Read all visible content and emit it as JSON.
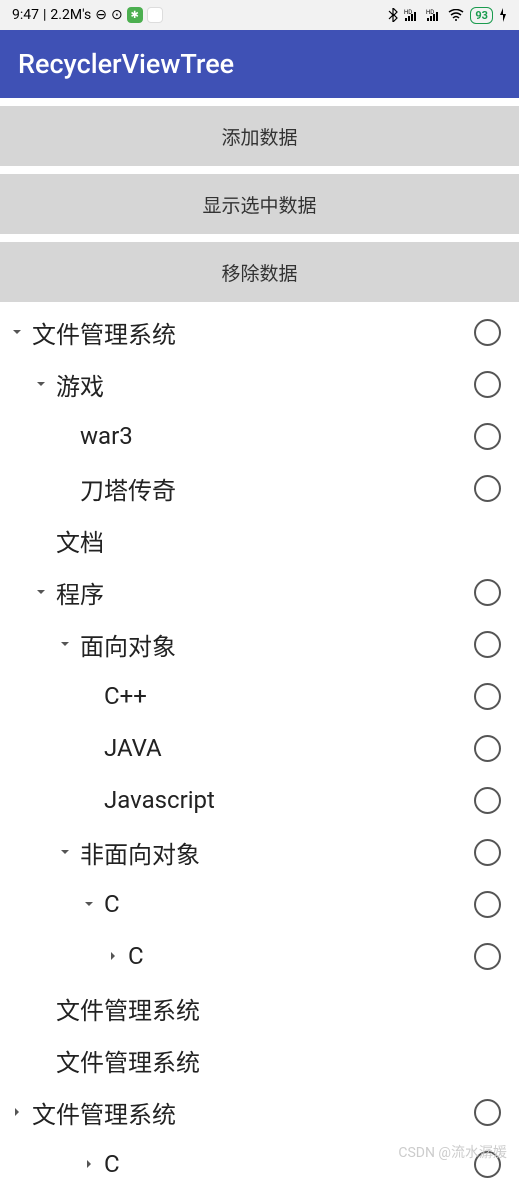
{
  "status": {
    "time": "9:47",
    "speed": "2.2M's",
    "battery": "93"
  },
  "appbar": {
    "title": "RecyclerViewTree"
  },
  "buttons": {
    "add": "添加数据",
    "show": "显示选中数据",
    "remove": "移除数据"
  },
  "tree": [
    {
      "label": "文件管理系统",
      "indent": 0,
      "arrow": "down",
      "radio": true
    },
    {
      "label": "游戏",
      "indent": 1,
      "arrow": "down",
      "radio": true
    },
    {
      "label": "war3",
      "indent": 2,
      "arrow": "none",
      "radio": true
    },
    {
      "label": "刀塔传奇",
      "indent": 2,
      "arrow": "none",
      "radio": true
    },
    {
      "label": "文档",
      "indent": 1,
      "arrow": "space",
      "radio": false
    },
    {
      "label": "程序",
      "indent": 1,
      "arrow": "down",
      "radio": true
    },
    {
      "label": "面向对象",
      "indent": 2,
      "arrow": "down",
      "radio": true
    },
    {
      "label": "C++",
      "indent": 3,
      "arrow": "none",
      "radio": true
    },
    {
      "label": "JAVA",
      "indent": 3,
      "arrow": "none",
      "radio": true
    },
    {
      "label": "Javascript",
      "indent": 3,
      "arrow": "none",
      "radio": true
    },
    {
      "label": "非面向对象",
      "indent": 2,
      "arrow": "down",
      "radio": true
    },
    {
      "label": "C",
      "indent": 3,
      "arrow": "down",
      "radio": true
    },
    {
      "label": "C",
      "indent": 4,
      "arrow": "right",
      "radio": true
    },
    {
      "label": "文件管理系统",
      "indent": 1,
      "arrow": "space",
      "radio": false
    },
    {
      "label": "文件管理系统",
      "indent": 1,
      "arrow": "space",
      "radio": false
    },
    {
      "label": "文件管理系统",
      "indent": 0,
      "arrow": "right",
      "radio": true
    },
    {
      "label": "C",
      "indent": 3,
      "arrow": "right",
      "radio": true
    }
  ],
  "watermark": "CSDN @流水潺媛"
}
